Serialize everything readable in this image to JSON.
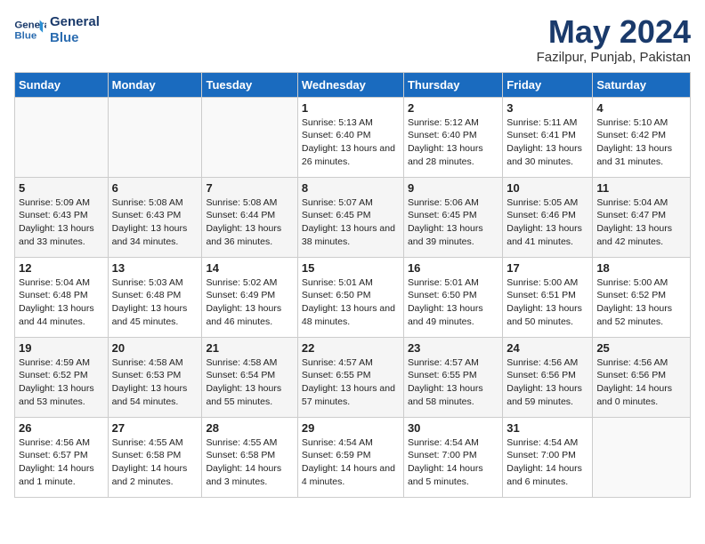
{
  "logo": {
    "line1": "General",
    "line2": "Blue"
  },
  "title": "May 2024",
  "subtitle": "Fazilpur, Punjab, Pakistan",
  "weekdays": [
    "Sunday",
    "Monday",
    "Tuesday",
    "Wednesday",
    "Thursday",
    "Friday",
    "Saturday"
  ],
  "weeks": [
    [
      {
        "day": "",
        "content": ""
      },
      {
        "day": "",
        "content": ""
      },
      {
        "day": "",
        "content": ""
      },
      {
        "day": "1",
        "content": "Sunrise: 5:13 AM\nSunset: 6:40 PM\nDaylight: 13 hours and 26 minutes."
      },
      {
        "day": "2",
        "content": "Sunrise: 5:12 AM\nSunset: 6:40 PM\nDaylight: 13 hours and 28 minutes."
      },
      {
        "day": "3",
        "content": "Sunrise: 5:11 AM\nSunset: 6:41 PM\nDaylight: 13 hours and 30 minutes."
      },
      {
        "day": "4",
        "content": "Sunrise: 5:10 AM\nSunset: 6:42 PM\nDaylight: 13 hours and 31 minutes."
      }
    ],
    [
      {
        "day": "5",
        "content": "Sunrise: 5:09 AM\nSunset: 6:43 PM\nDaylight: 13 hours and 33 minutes."
      },
      {
        "day": "6",
        "content": "Sunrise: 5:08 AM\nSunset: 6:43 PM\nDaylight: 13 hours and 34 minutes."
      },
      {
        "day": "7",
        "content": "Sunrise: 5:08 AM\nSunset: 6:44 PM\nDaylight: 13 hours and 36 minutes."
      },
      {
        "day": "8",
        "content": "Sunrise: 5:07 AM\nSunset: 6:45 PM\nDaylight: 13 hours and 38 minutes."
      },
      {
        "day": "9",
        "content": "Sunrise: 5:06 AM\nSunset: 6:45 PM\nDaylight: 13 hours and 39 minutes."
      },
      {
        "day": "10",
        "content": "Sunrise: 5:05 AM\nSunset: 6:46 PM\nDaylight: 13 hours and 41 minutes."
      },
      {
        "day": "11",
        "content": "Sunrise: 5:04 AM\nSunset: 6:47 PM\nDaylight: 13 hours and 42 minutes."
      }
    ],
    [
      {
        "day": "12",
        "content": "Sunrise: 5:04 AM\nSunset: 6:48 PM\nDaylight: 13 hours and 44 minutes."
      },
      {
        "day": "13",
        "content": "Sunrise: 5:03 AM\nSunset: 6:48 PM\nDaylight: 13 hours and 45 minutes."
      },
      {
        "day": "14",
        "content": "Sunrise: 5:02 AM\nSunset: 6:49 PM\nDaylight: 13 hours and 46 minutes."
      },
      {
        "day": "15",
        "content": "Sunrise: 5:01 AM\nSunset: 6:50 PM\nDaylight: 13 hours and 48 minutes."
      },
      {
        "day": "16",
        "content": "Sunrise: 5:01 AM\nSunset: 6:50 PM\nDaylight: 13 hours and 49 minutes."
      },
      {
        "day": "17",
        "content": "Sunrise: 5:00 AM\nSunset: 6:51 PM\nDaylight: 13 hours and 50 minutes."
      },
      {
        "day": "18",
        "content": "Sunrise: 5:00 AM\nSunset: 6:52 PM\nDaylight: 13 hours and 52 minutes."
      }
    ],
    [
      {
        "day": "19",
        "content": "Sunrise: 4:59 AM\nSunset: 6:52 PM\nDaylight: 13 hours and 53 minutes."
      },
      {
        "day": "20",
        "content": "Sunrise: 4:58 AM\nSunset: 6:53 PM\nDaylight: 13 hours and 54 minutes."
      },
      {
        "day": "21",
        "content": "Sunrise: 4:58 AM\nSunset: 6:54 PM\nDaylight: 13 hours and 55 minutes."
      },
      {
        "day": "22",
        "content": "Sunrise: 4:57 AM\nSunset: 6:55 PM\nDaylight: 13 hours and 57 minutes."
      },
      {
        "day": "23",
        "content": "Sunrise: 4:57 AM\nSunset: 6:55 PM\nDaylight: 13 hours and 58 minutes."
      },
      {
        "day": "24",
        "content": "Sunrise: 4:56 AM\nSunset: 6:56 PM\nDaylight: 13 hours and 59 minutes."
      },
      {
        "day": "25",
        "content": "Sunrise: 4:56 AM\nSunset: 6:56 PM\nDaylight: 14 hours and 0 minutes."
      }
    ],
    [
      {
        "day": "26",
        "content": "Sunrise: 4:56 AM\nSunset: 6:57 PM\nDaylight: 14 hours and 1 minute."
      },
      {
        "day": "27",
        "content": "Sunrise: 4:55 AM\nSunset: 6:58 PM\nDaylight: 14 hours and 2 minutes."
      },
      {
        "day": "28",
        "content": "Sunrise: 4:55 AM\nSunset: 6:58 PM\nDaylight: 14 hours and 3 minutes."
      },
      {
        "day": "29",
        "content": "Sunrise: 4:54 AM\nSunset: 6:59 PM\nDaylight: 14 hours and 4 minutes."
      },
      {
        "day": "30",
        "content": "Sunrise: 4:54 AM\nSunset: 7:00 PM\nDaylight: 14 hours and 5 minutes."
      },
      {
        "day": "31",
        "content": "Sunrise: 4:54 AM\nSunset: 7:00 PM\nDaylight: 14 hours and 6 minutes."
      },
      {
        "day": "",
        "content": ""
      }
    ]
  ]
}
